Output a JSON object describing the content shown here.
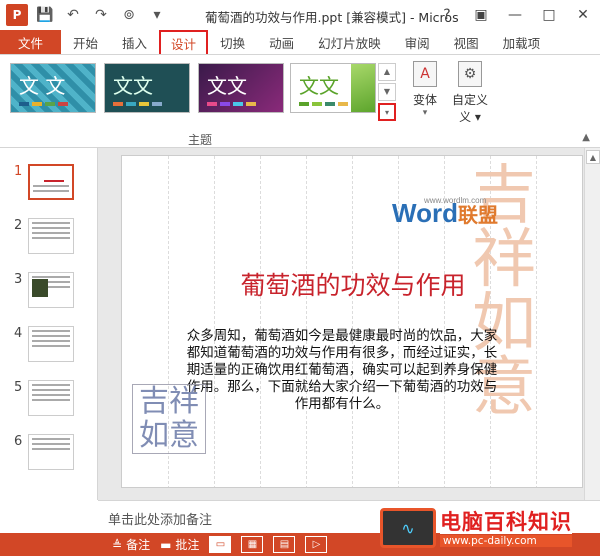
{
  "window": {
    "title": "葡萄酒的功效与作用.ppt [兼容模式] - Micros",
    "app_logo": "P",
    "controls": [
      "?",
      "▣",
      "—",
      "□",
      "✕"
    ]
  },
  "quick_access": {
    "icons": [
      "save-icon",
      "undo-icon",
      "redo-icon",
      "slideshow-icon"
    ]
  },
  "tabs": [
    "文件",
    "开始",
    "插入",
    "设计",
    "切换",
    "动画",
    "幻灯片放映",
    "审阅",
    "视图",
    "加载项"
  ],
  "active_tab": "设计",
  "ribbon": {
    "theme_text": "文文",
    "theme_sample_glyph": "文 文",
    "group_label": "主题",
    "variants_label": "变体",
    "customize_label": "自定义",
    "customize_sub": "义 ▾",
    "more_button": "▾"
  },
  "thumbnails": [
    "1",
    "2",
    "3",
    "4",
    "5",
    "6"
  ],
  "selected_slide": "1",
  "slide": {
    "title": "葡萄酒的功效与作用",
    "body": "众多周知，葡萄酒如今是最健康最时尚的饮品，大家都知道葡萄酒的功效与作用有很多，而经过证实，长期适量的正确饮用红葡萄酒，确实可以起到养身保健作用。那么，下面就给大家介绍一下葡萄酒的功效与作用都有什么。",
    "logo_word": "Word",
    "logo_cn": "联盟",
    "logo_url": "www.wordlm.com",
    "watermark": "吉祥如意",
    "seal_text": "吉祥如意"
  },
  "notes": {
    "placeholder": "单击此处添加备注"
  },
  "statusbar": {
    "notes_label": "备注",
    "comments_label": "批注"
  },
  "brand": {
    "name": "电脑百科知识",
    "url": "www.pc-daily.com"
  },
  "colors": {
    "accent": "#d24726",
    "highlight_box": "#e02020",
    "slide_title": "#c8232c"
  }
}
